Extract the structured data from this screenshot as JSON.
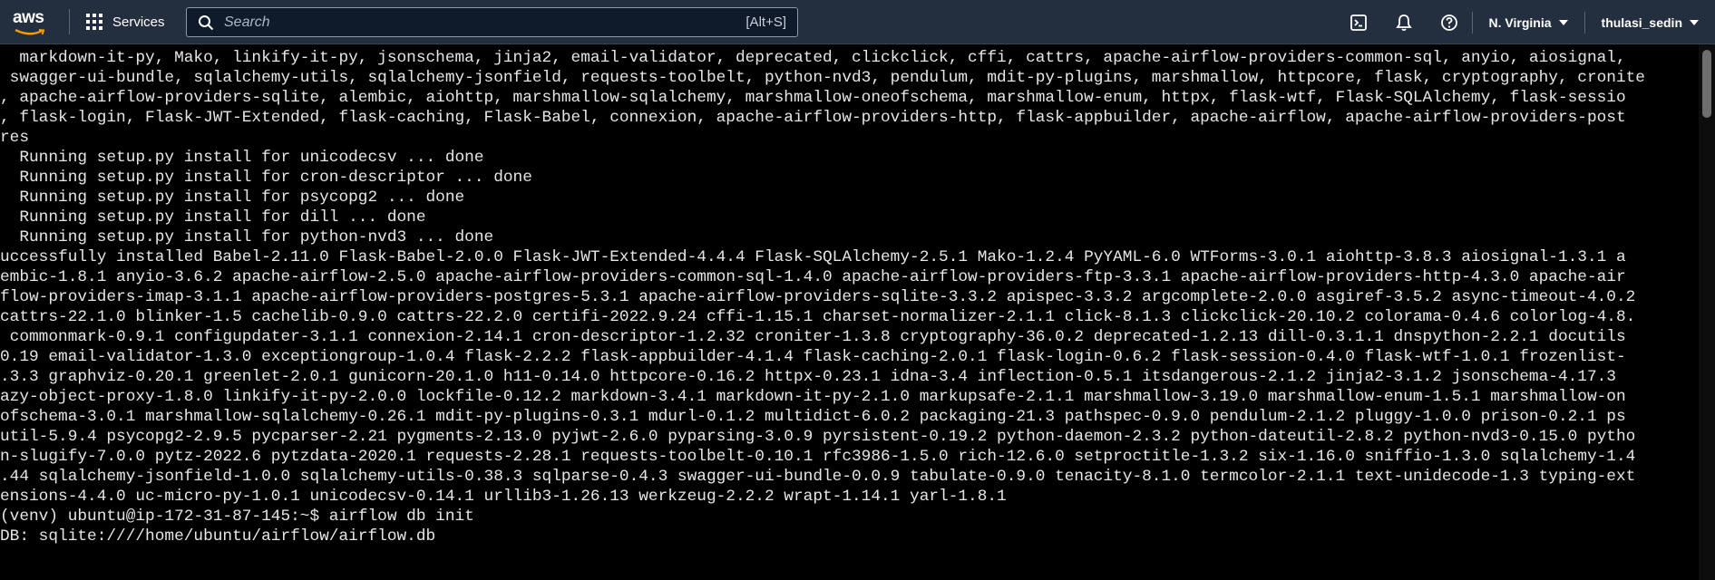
{
  "header": {
    "logo_text": "aws",
    "services_label": "Services",
    "search_placeholder": "Search",
    "search_shortcut": "[Alt+S]",
    "region": "N. Virginia",
    "user": "thulasi_sedin",
    "icons": [
      "cloudshell-icon",
      "bell-icon",
      "help-icon"
    ]
  },
  "terminal": {
    "lines": [
      "  markdown-it-py, Mako, linkify-it-py, jsonschema, jinja2, email-validator, deprecated, clickclick, cffi, cattrs, apache-airflow-providers-common-sql, anyio, aiosignal, ",
      " swagger-ui-bundle, sqlalchemy-utils, sqlalchemy-jsonfield, requests-toolbelt, python-nvd3, pendulum, mdit-py-plugins, marshmallow, httpcore, flask, cryptography, cronite",
      ", apache-airflow-providers-sqlite, alembic, aiohttp, marshmallow-sqlalchemy, marshmallow-oneofschema, marshmallow-enum, httpx, flask-wtf, Flask-SQLAlchemy, flask-sessio",
      ", flask-login, Flask-JWT-Extended, flask-caching, Flask-Babel, connexion, apache-airflow-providers-http, flask-appbuilder, apache-airflow, apache-airflow-providers-post",
      "res",
      "  Running setup.py install for unicodecsv ... done",
      "  Running setup.py install for cron-descriptor ... done",
      "  Running setup.py install for psycopg2 ... done",
      "  Running setup.py install for dill ... done",
      "  Running setup.py install for python-nvd3 ... done",
      "uccessfully installed Babel-2.11.0 Flask-Babel-2.0.0 Flask-JWT-Extended-4.4.4 Flask-SQLAlchemy-2.5.1 Mako-1.2.4 PyYAML-6.0 WTForms-3.0.1 aiohttp-3.8.3 aiosignal-1.3.1 a",
      "embic-1.8.1 anyio-3.6.2 apache-airflow-2.5.0 apache-airflow-providers-common-sql-1.4.0 apache-airflow-providers-ftp-3.3.1 apache-airflow-providers-http-4.3.0 apache-air",
      "flow-providers-imap-3.1.1 apache-airflow-providers-postgres-5.3.1 apache-airflow-providers-sqlite-3.3.2 apispec-3.3.2 argcomplete-2.0.0 asgiref-3.5.2 async-timeout-4.0.2",
      "cattrs-22.1.0 blinker-1.5 cachelib-0.9.0 cattrs-22.2.0 certifi-2022.9.24 cffi-1.15.1 charset-normalizer-2.1.1 click-8.1.3 clickclick-20.10.2 colorama-0.4.6 colorlog-4.8.",
      " commonmark-0.9.1 configupdater-3.1.1 connexion-2.14.1 cron-descriptor-1.2.32 croniter-1.3.8 cryptography-36.0.2 deprecated-1.2.13 dill-0.3.1.1 dnspython-2.2.1 docutils",
      "0.19 email-validator-1.3.0 exceptiongroup-1.0.4 flask-2.2.2 flask-appbuilder-4.1.4 flask-caching-2.0.1 flask-login-0.6.2 flask-session-0.4.0 flask-wtf-1.0.1 frozenlist-",
      ".3.3 graphviz-0.20.1 greenlet-2.0.1 gunicorn-20.1.0 h11-0.14.0 httpcore-0.16.2 httpx-0.23.1 idna-3.4 inflection-0.5.1 itsdangerous-2.1.2 jinja2-3.1.2 jsonschema-4.17.3",
      "azy-object-proxy-1.8.0 linkify-it-py-2.0.0 lockfile-0.12.2 markdown-3.4.1 markdown-it-py-2.1.0 markupsafe-2.1.1 marshmallow-3.19.0 marshmallow-enum-1.5.1 marshmallow-on",
      "ofschema-3.0.1 marshmallow-sqlalchemy-0.26.1 mdit-py-plugins-0.3.1 mdurl-0.1.2 multidict-6.0.2 packaging-21.3 pathspec-0.9.0 pendulum-2.1.2 pluggy-1.0.0 prison-0.2.1 ps",
      "util-5.9.4 psycopg2-2.9.5 pycparser-2.21 pygments-2.13.0 pyjwt-2.6.0 pyparsing-3.0.9 pyrsistent-0.19.2 python-daemon-2.3.2 python-dateutil-2.8.2 python-nvd3-0.15.0 pytho",
      "n-slugify-7.0.0 pytz-2022.6 pytzdata-2020.1 requests-2.28.1 requests-toolbelt-0.10.1 rfc3986-1.5.0 rich-12.6.0 setproctitle-1.3.2 six-1.16.0 sniffio-1.3.0 sqlalchemy-1.4",
      ".44 sqlalchemy-jsonfield-1.0.0 sqlalchemy-utils-0.38.3 sqlparse-0.4.3 swagger-ui-bundle-0.0.9 tabulate-0.9.0 tenacity-8.1.0 termcolor-2.1.1 text-unidecode-1.3 typing-ext",
      "ensions-4.4.0 uc-micro-py-1.0.1 unicodecsv-0.14.1 urllib3-1.26.13 werkzeug-2.2.2 wrapt-1.14.1 yarl-1.8.1",
      "(venv) ubuntu@ip-172-31-87-145:~$ airflow db init",
      "DB: sqlite:////home/ubuntu/airflow/airflow.db"
    ]
  }
}
